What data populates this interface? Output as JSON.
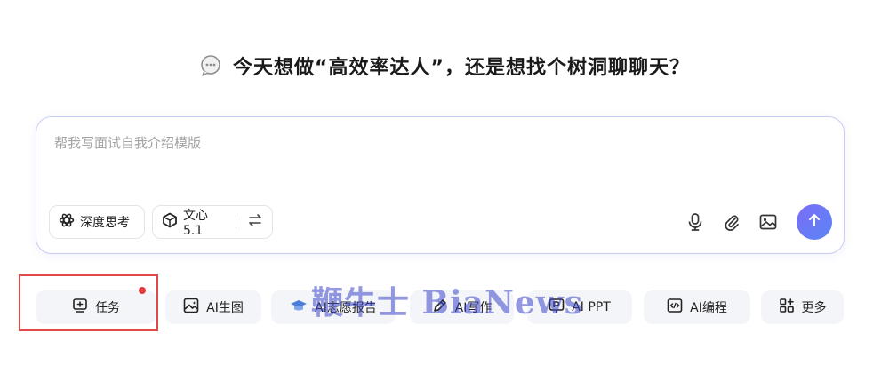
{
  "headline": {
    "text": "今天想做“高效率达人”，还是想找个树洞聊聊天？",
    "icon": "chat-bubble-icon"
  },
  "input": {
    "placeholder": "帮我写面试自我介绍模版"
  },
  "modes": {
    "deep_think": {
      "label": "深度思考",
      "icon": "atom-icon"
    },
    "model": {
      "label": "文心5.1",
      "icon": "cube-icon",
      "switch_icon": "swap-icon"
    }
  },
  "tools": {
    "mic": "microphone-icon",
    "attach": "paperclip-icon",
    "image": "image-icon",
    "send": "arrow-up-icon"
  },
  "chips": [
    {
      "label": "任务",
      "icon": "task-icon"
    },
    {
      "label": "AI生图",
      "icon": "image-gen-icon"
    },
    {
      "label": "AI志愿报告",
      "icon": "graduation-cap-icon"
    },
    {
      "label": "AI写作",
      "icon": "pen-icon"
    },
    {
      "label": "AI PPT",
      "icon": "ppt-icon"
    },
    {
      "label": "AI编程",
      "icon": "code-icon"
    },
    {
      "label": "更多",
      "icon": "grid-plus-icon"
    }
  ],
  "watermark": "鞭牛士 BiaNews",
  "colors": {
    "accent": "#6b78f6",
    "highlight_border": "#e0494a",
    "chip_bg": "#f4f5f8"
  }
}
